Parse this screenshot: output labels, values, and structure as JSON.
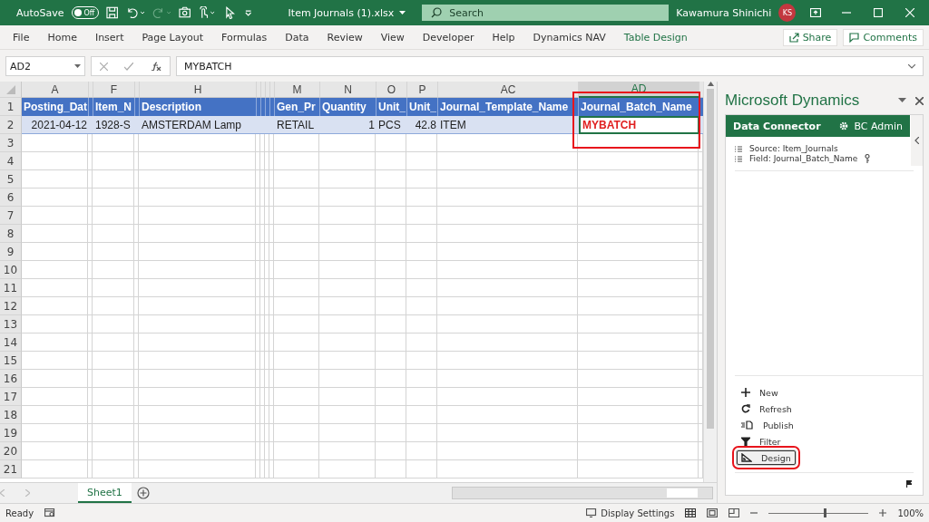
{
  "title_bar": {
    "autosave_label": "AutoSave",
    "autosave_toggle": {
      "label": "Off",
      "on": false
    },
    "file_name": "Item Journals (1).xlsx",
    "search": {
      "placeholder": "Search"
    },
    "user_name": "Kawamura Shinichi",
    "avatar": "KS"
  },
  "ribbon_tabs": [
    {
      "label": "File",
      "kind": "normal"
    },
    {
      "label": "Home",
      "kind": "normal"
    },
    {
      "label": "Insert",
      "kind": "normal"
    },
    {
      "label": "Page Layout",
      "kind": "normal"
    },
    {
      "label": "Formulas",
      "kind": "normal"
    },
    {
      "label": "Data",
      "kind": "normal"
    },
    {
      "label": "Review",
      "kind": "normal"
    },
    {
      "label": "View",
      "kind": "normal"
    },
    {
      "label": "Developer",
      "kind": "normal"
    },
    {
      "label": "Help",
      "kind": "normal"
    },
    {
      "label": "Dynamics NAV",
      "kind": "normal"
    },
    {
      "label": "Table Design",
      "kind": "contextual"
    }
  ],
  "ribbon_buttons": [
    "Share",
    "Comments"
  ],
  "formula_bar": {
    "name_box": "AD2",
    "formula": "MYBATCH"
  },
  "sheet": {
    "columns": [
      {
        "kind": "wide",
        "letter": "A",
        "header": "Posting_Dat",
        "value": "2021-04-12",
        "numeric": true,
        "selected": false,
        "highlighted": false
      },
      {
        "kind": "narrow"
      },
      {
        "kind": "wide",
        "letter": "F",
        "header": "Item_N",
        "value": "1928-S",
        "numeric": false,
        "selected": false,
        "highlighted": false
      },
      {
        "kind": "narrow"
      },
      {
        "kind": "wide",
        "letter": "H",
        "header": "Description",
        "value": "AMSTERDAM Lamp",
        "numeric": false,
        "selected": false,
        "highlighted": false
      },
      {
        "kind": "narrow"
      },
      {
        "kind": "narrow"
      },
      {
        "kind": "narrow"
      },
      {
        "kind": "narrow"
      },
      {
        "kind": "wide",
        "letter": "M",
        "header": "Gen_Pr",
        "value": "RETAIL",
        "numeric": false,
        "selected": false,
        "highlighted": false
      },
      {
        "kind": "wide",
        "letter": "N",
        "header": "Quantity",
        "value": "1",
        "numeric": true,
        "selected": false,
        "highlighted": false
      },
      {
        "kind": "wide",
        "letter": "O",
        "header": "Unit_",
        "value": "PCS",
        "numeric": false,
        "selected": false,
        "highlighted": false
      },
      {
        "kind": "wide",
        "letter": "P",
        "header": "Unit_",
        "value": "42.8",
        "numeric": true,
        "selected": false,
        "highlighted": false
      },
      {
        "kind": "wide",
        "letter": "AC",
        "header": "Journal_Template_Name",
        "value": "ITEM",
        "numeric": false,
        "selected": false,
        "highlighted": false
      },
      {
        "kind": "wide",
        "letter": "AD",
        "header": "Journal_Batch_Name",
        "value": "MYBATCH",
        "numeric": false,
        "selected": true,
        "highlighted": true
      },
      {
        "kind": "narrow"
      }
    ],
    "row_numbers": [
      "1",
      "2",
      "3",
      "4",
      "5",
      "6",
      "7",
      "8",
      "9",
      "10",
      "11",
      "12",
      "13",
      "14",
      "15",
      "16",
      "17",
      "18",
      "19",
      "20",
      "21"
    ],
    "sheet_tabs": [
      {
        "label": "Sheet1",
        "selected": true
      }
    ]
  },
  "pane": {
    "title": "Microsoft Dynamics",
    "header": "Data Connector",
    "user": "BC Admin",
    "info": [
      "Source: Item_Journals",
      "Field: Journal_Batch_Name"
    ],
    "actions": [
      {
        "label": "New",
        "kind": "new",
        "selected": false,
        "highlighted": false
      },
      {
        "label": "Refresh",
        "kind": "refresh",
        "selected": false,
        "highlighted": false
      },
      {
        "label": "Publish",
        "kind": "publish",
        "selected": false,
        "highlighted": false
      },
      {
        "label": "Filter",
        "kind": "filter",
        "selected": false,
        "highlighted": false
      },
      {
        "label": "Design",
        "kind": "design",
        "selected": true,
        "highlighted": true
      }
    ]
  },
  "status_bar": {
    "status": "Ready",
    "display_settings": "Display Settings",
    "zoom": {
      "level": 0.55,
      "reading": "100%"
    }
  }
}
